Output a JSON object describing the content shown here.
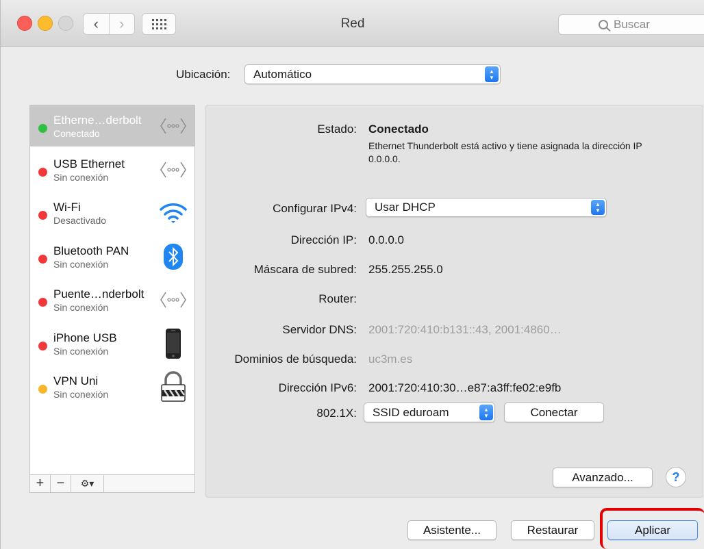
{
  "window": {
    "title": "Red"
  },
  "toolbar": {
    "search_placeholder": "Buscar"
  },
  "location": {
    "label": "Ubicación:",
    "value": "Automático"
  },
  "services": [
    {
      "name": "Etherne…derbolt",
      "status": "Conectado",
      "status_color": "#2fc042",
      "icon": "ethernet-icon",
      "selected": true
    },
    {
      "name": "USB Ethernet",
      "status": "Sin conexión",
      "status_color": "#f2383a",
      "icon": "ethernet-icon"
    },
    {
      "name": "Wi-Fi",
      "status": "Desactivado",
      "status_color": "#f2383a",
      "icon": "wifi-icon"
    },
    {
      "name": "Bluetooth PAN",
      "status": "Sin conexión",
      "status_color": "#f2383a",
      "icon": "bluetooth-icon"
    },
    {
      "name": "Puente…nderbolt",
      "status": "Sin conexión",
      "status_color": "#f2383a",
      "icon": "ethernet-icon"
    },
    {
      "name": "iPhone USB",
      "status": "Sin conexión",
      "status_color": "#f2383a",
      "icon": "iphone-icon"
    },
    {
      "name": "VPN Uni",
      "status": "Sin conexión",
      "status_color": "#f7b52c",
      "icon": "lock-icon"
    }
  ],
  "sidebar_buttons": {
    "add": "+",
    "remove": "−"
  },
  "detail": {
    "status_label": "Estado:",
    "status_value": "Conectado",
    "status_description": "Ethernet Thunderbolt está activo y tiene asignada la dirección IP 0.0.0.0.",
    "configure_ipv4_label": "Configurar IPv4:",
    "configure_ipv4_value": "Usar DHCP",
    "ip_label": "Dirección IP:",
    "ip_value": "0.0.0.0",
    "subnet_label": "Máscara de subred:",
    "subnet_value": "255.255.255.0",
    "router_label": "Router:",
    "router_value": "",
    "dns_label": "Servidor DNS:",
    "dns_value": "2001:720:410:b131::43, 2001:4860…",
    "search_domains_label": "Dominios de búsqueda:",
    "search_domains_value": "uc3m.es",
    "ipv6_label": "Dirección IPv6:",
    "ipv6_value": "2001:720:410:30…e87:a3ff:fe02:e9fb",
    "dot1x_label": "802.1X:",
    "dot1x_value": "SSID eduroam",
    "connect_button": "Conectar",
    "advanced_button": "Avanzado...",
    "help_button": "?"
  },
  "footer": {
    "assistant_button": "Asistente...",
    "revert_button": "Restaurar",
    "apply_button": "Aplicar"
  }
}
